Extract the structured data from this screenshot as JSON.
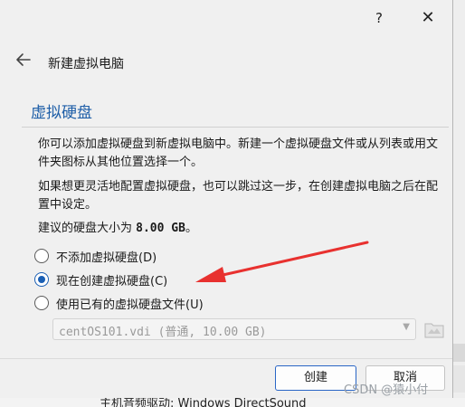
{
  "window": {
    "help_label": "?",
    "close_label": "✕"
  },
  "wizard": {
    "title": "新建虚拟电脑",
    "back_icon": "arrow-left-icon"
  },
  "page": {
    "heading": "虚拟硬盘",
    "para1": "你可以添加虚拟硬盘到新虚拟电脑中。新建一个虚拟硬盘文件或从列表或用文件夹图标从其他位置选择一个。",
    "para2": "如果想更灵活地配置虚拟硬盘，也可以跳过这一步，在创建虚拟电脑之后在配置中设定。",
    "recommend_prefix": "建议的硬盘大小为 ",
    "recommend_value": "8.00 GB",
    "recommend_suffix": "。"
  },
  "options": [
    {
      "label": "不添加虚拟硬盘(D)",
      "checked": false
    },
    {
      "label": "现在创建虚拟硬盘(C)",
      "checked": true
    },
    {
      "label": "使用已有的虚拟硬盘文件(U)",
      "checked": false
    }
  ],
  "existing_file": {
    "value": "centOS101.vdi (普通, 10.00 GB)",
    "enabled": false
  },
  "buttons": {
    "create": "创建",
    "cancel": "取消"
  },
  "background": {
    "bottom_text": "主机音频驱动: Windows DirectSound"
  },
  "watermark": "CSDN @猿小付",
  "colors": {
    "accent": "#1a5fb4",
    "heading": "#1f5fa8",
    "annotation_arrow": "#e8312f"
  }
}
